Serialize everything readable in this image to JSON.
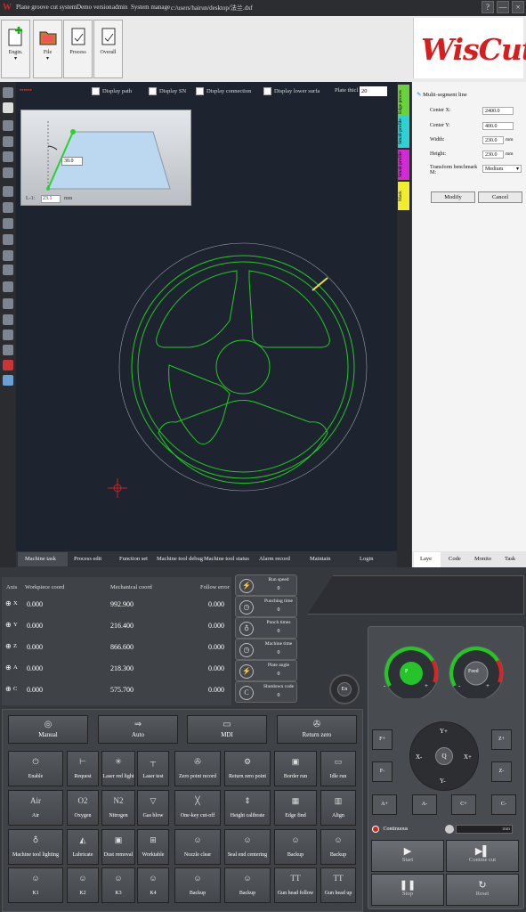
{
  "titlebar": {
    "app_name": "Plane groove cut system",
    "version": "Demo version",
    "user": "admin",
    "system_manage": "System manage",
    "file_path": "c:/users/hairun/desktop/法兰.dxf",
    "help": "?",
    "minimize": "—",
    "close": "×"
  },
  "toolbar": [
    {
      "label": "Engin.",
      "sub": "▾"
    },
    {
      "label": "File",
      "sub": "▾"
    },
    {
      "label": "Process",
      "sub": ""
    },
    {
      "label": "Overall",
      "sub": ""
    }
  ],
  "logo": {
    "text": "WisCut"
  },
  "canvas": {
    "display_options": [
      "Display path",
      "Display SN",
      "Display connection",
      "Display lower surfa"
    ],
    "plate_thickness_label": "Plate thicl",
    "plate_thickness_value": "20",
    "preview_angle": "30.0",
    "preview_l1_label": "L-1:",
    "preview_l1_value": "23.1",
    "preview_l1_unit": "mm"
  },
  "vertical_tabs": [
    "Edge proces",
    "Small profile",
    "Small profile",
    "Mark"
  ],
  "right_panel": {
    "title": "Multi-segment line",
    "fields": [
      {
        "label": "Center X:",
        "value": "2400.0",
        "unit": ""
      },
      {
        "label": "Center Y:",
        "value": "400.0",
        "unit": ""
      },
      {
        "label": "Width:",
        "value": "230.0",
        "unit": "mm"
      },
      {
        "label": "Height:",
        "value": "230.0",
        "unit": "mm"
      }
    ],
    "transform_label": "Transform benchmark M:",
    "transform_value": "Medium",
    "modify": "Modify",
    "cancel": "Cancel",
    "tabs": [
      "Laye",
      "Code",
      "Monito",
      "Task"
    ]
  },
  "bottom_tabs": [
    "Machine task",
    "Process edit",
    "Function set",
    "Machine tool debug",
    "Machine tool status",
    "Alarm record",
    "Maintain",
    "Login"
  ],
  "axes": {
    "headers": [
      "Axis",
      "Workpiece coord",
      "Mechanical coord",
      "Follow error"
    ],
    "rows": [
      {
        "axis": "X",
        "work": "0.000",
        "mech": "992.900",
        "err": "0.000"
      },
      {
        "axis": "Y",
        "work": "0.000",
        "mech": "216.400",
        "err": "0.000"
      },
      {
        "axis": "Z",
        "work": "0.000",
        "mech": "866.600",
        "err": "0.000"
      },
      {
        "axis": "A",
        "work": "0.000",
        "mech": "218.300",
        "err": "0.000"
      },
      {
        "axis": "C",
        "work": "0.000",
        "mech": "575.700",
        "err": "0.000"
      }
    ]
  },
  "stats": [
    {
      "title": "Run speed",
      "value": "0",
      "icon": "⚡"
    },
    {
      "title": "Punching time",
      "value": "0",
      "icon": "◷"
    },
    {
      "title": "Punch times",
      "value": "0",
      "icon": "♁"
    },
    {
      "title": "Machine time",
      "value": "0",
      "icon": "◷"
    },
    {
      "title": "Plate angle",
      "value": "0",
      "icon": "⚡"
    },
    {
      "title": "Shutdown code",
      "value": "0",
      "icon": "C"
    }
  ],
  "en_button": "En",
  "modes": [
    {
      "label": "Manual",
      "icon": "◎"
    },
    {
      "label": "Auto",
      "icon": "⇒"
    },
    {
      "label": "MDI",
      "icon": "▭"
    },
    {
      "label": "Return zero",
      "icon": "✇"
    }
  ],
  "functions_left": [
    [
      {
        "label": "Enable",
        "icon": "⏻"
      },
      {
        "label": "Request",
        "icon": "⊢"
      },
      {
        "label": "Laser red light",
        "icon": "✳"
      },
      {
        "label": "Laser test",
        "icon": "┬"
      }
    ],
    [
      {
        "label": "Air",
        "icon": "Air"
      },
      {
        "label": "Oxygen",
        "icon": "O2"
      },
      {
        "label": "Nitrogen",
        "icon": "N2"
      },
      {
        "label": "Gas blow",
        "icon": "▽"
      }
    ],
    [
      {
        "label": "Machine tool lighting",
        "icon": "♁"
      },
      {
        "label": "Lubricate",
        "icon": "◭"
      },
      {
        "label": "Dust removal",
        "icon": "▣"
      },
      {
        "label": "Worktable",
        "icon": "⊞"
      }
    ],
    [
      {
        "label": "K1",
        "icon": "☺"
      },
      {
        "label": "K2",
        "icon": "☺"
      },
      {
        "label": "K3",
        "icon": "☺"
      },
      {
        "label": "K4",
        "icon": "☺"
      }
    ]
  ],
  "functions_right": [
    [
      {
        "label": "Zero point record",
        "icon": "✇"
      },
      {
        "label": "Return zero point",
        "icon": "⚙"
      },
      {
        "label": "Border run",
        "icon": "▣"
      },
      {
        "label": "Idle run",
        "icon": "▭"
      }
    ],
    [
      {
        "label": "One-key cut-off",
        "icon": "╳"
      },
      {
        "label": "Height calibrate",
        "icon": "⇕"
      },
      {
        "label": "Edge find",
        "icon": "▦"
      },
      {
        "label": "Align",
        "icon": "▥"
      }
    ],
    [
      {
        "label": "Nozzle clear",
        "icon": "☺"
      },
      {
        "label": "Seal end centering",
        "icon": "☺"
      },
      {
        "label": "Backup",
        "icon": "☺"
      },
      {
        "label": "Backup",
        "icon": "☺"
      }
    ],
    [
      {
        "label": "Backup",
        "icon": "☺"
      },
      {
        "label": "Backup",
        "icon": "☺"
      },
      {
        "label": "Gun head follow",
        "icon": "TT"
      },
      {
        "label": "Gun head up",
        "icon": "TT"
      }
    ]
  ],
  "jog": {
    "gauge1_label": "P",
    "gauge1_minus": "-",
    "gauge1_plus": "+",
    "gauge2_label": "Feed",
    "gauge2_minus": "-",
    "gauge2_plus": "+",
    "gauge_ticks": [
      "0",
      "120",
      "20",
      "100",
      "80"
    ],
    "f_plus": "F+",
    "f_minus": "F-",
    "z_plus": "Z+",
    "z_minus": "Z-",
    "y_plus": "Y+",
    "y_minus": "Y-",
    "x_plus": "X+",
    "x_minus": "X-",
    "q": "Q",
    "a_plus": "A+",
    "a_minus": "A-",
    "c_plus": "C+",
    "c_minus": "C-",
    "continuous": "Continuous",
    "step_unit": "mm"
  },
  "run_buttons": [
    {
      "label": "Start",
      "icon": "▶"
    },
    {
      "label": "Contine cut",
      "icon": "▶▌"
    },
    {
      "label": "Stop",
      "icon": "❚❚"
    },
    {
      "label": "Reset",
      "icon": "↻"
    }
  ],
  "colors": {
    "canvas_bg": "#1d2430",
    "part_green": "#22c922",
    "lead_yellow": "#e8e33a",
    "logo_red": "#d61e1e"
  }
}
